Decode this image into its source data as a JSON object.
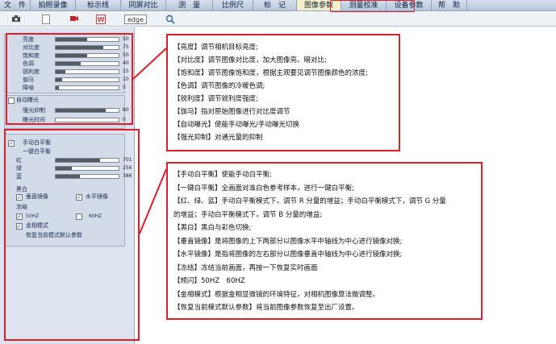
{
  "menu": {
    "items": [
      "文　件",
      "拍照录像",
      "标示线",
      "同屏对比",
      "测　量",
      "比例尺",
      "标　记",
      "图像参数",
      "测量校准",
      "设备参数",
      "帮　助"
    ]
  },
  "toolbar": {
    "edge_label": "edge"
  },
  "image_params": {
    "sliders": [
      {
        "label": "亮度",
        "value": 50,
        "max": 100
      },
      {
        "label": "对比度",
        "value": 75,
        "max": 100
      },
      {
        "label": "饱和度",
        "value": 50,
        "max": 100
      },
      {
        "label": "色调",
        "value": 40,
        "max": 100
      },
      {
        "label": "锐利度",
        "value": 15,
        "max": 100
      },
      {
        "label": "伽马",
        "value": 10,
        "max": 100
      },
      {
        "label": "降噪",
        "value": 5,
        "max": 100
      }
    ],
    "auto_exposure": "自动曝光",
    "exposure_sliders": [
      {
        "label": "强光抑制",
        "value": 80,
        "max": 100
      },
      {
        "label": "曝光时间",
        "value": 0,
        "max": 100
      }
    ]
  },
  "white_balance": {
    "manual": "手动白平衡",
    "one_key": "一键白平衡",
    "sliders": [
      {
        "label": "红",
        "value": 701,
        "max": 1000
      },
      {
        "label": "绿",
        "value": 256,
        "max": 1000
      },
      {
        "label": "蓝",
        "value": 386,
        "max": 1000
      }
    ],
    "bw": "黑白",
    "v_mirror": "垂直镜像",
    "h_mirror": "水平镜像",
    "freeze": "冻结",
    "hz50": "50HZ",
    "hz60": "60HZ",
    "metal": "金相模式",
    "restore": "恢复当前模式默认参数"
  },
  "callout_top": [
    "【亮度】调节相机目标亮度;",
    "【对比度】调节图像对比度，加大图像亮、暗对比;",
    "【饱和度】调节图像饱和度，根据主观要见调节图像颜色的浓度;",
    "【色调】调节图像的冷暖色调;",
    "【锐利度】调节锐利度强度;",
    "【伽马】指对原始图像进行对比度调节",
    "【自动曝光】使能手动曝光/手动曝光切换",
    "【强光抑制】对通光量的抑制"
  ],
  "callout_bottom": [
    "【手动白平衡】使能手动白平衡;",
    "【一键白平衡】全画面对准白色参考样本，进行一键白平衡;",
    "【红、绿、蓝】手动白平衡模式下，调节 R 分量的增益；手动白平衡模式下，调节 G 分量",
    "的增益；手动白平衡模式下，调节 B 分量的增益;",
    "【黑白】黑白与彩色切换;",
    "【垂直镜像】是将图像的上下两部分以图像水平中轴线为中心进行镜像对换;",
    "【水平镜像】是指将图像的左右部分以图像垂直中轴线为中心进行镜像对换;",
    "【冻结】冻结当前画面，再按一下恢复实时画面",
    "【频闪】50HZ　60HZ",
    "【金相模式】根据金相显微镜的环境特征，对相机图像算法做调整。",
    "【恢复当前模式默认参数】将当前图像参数恢复至出厂设置。"
  ]
}
